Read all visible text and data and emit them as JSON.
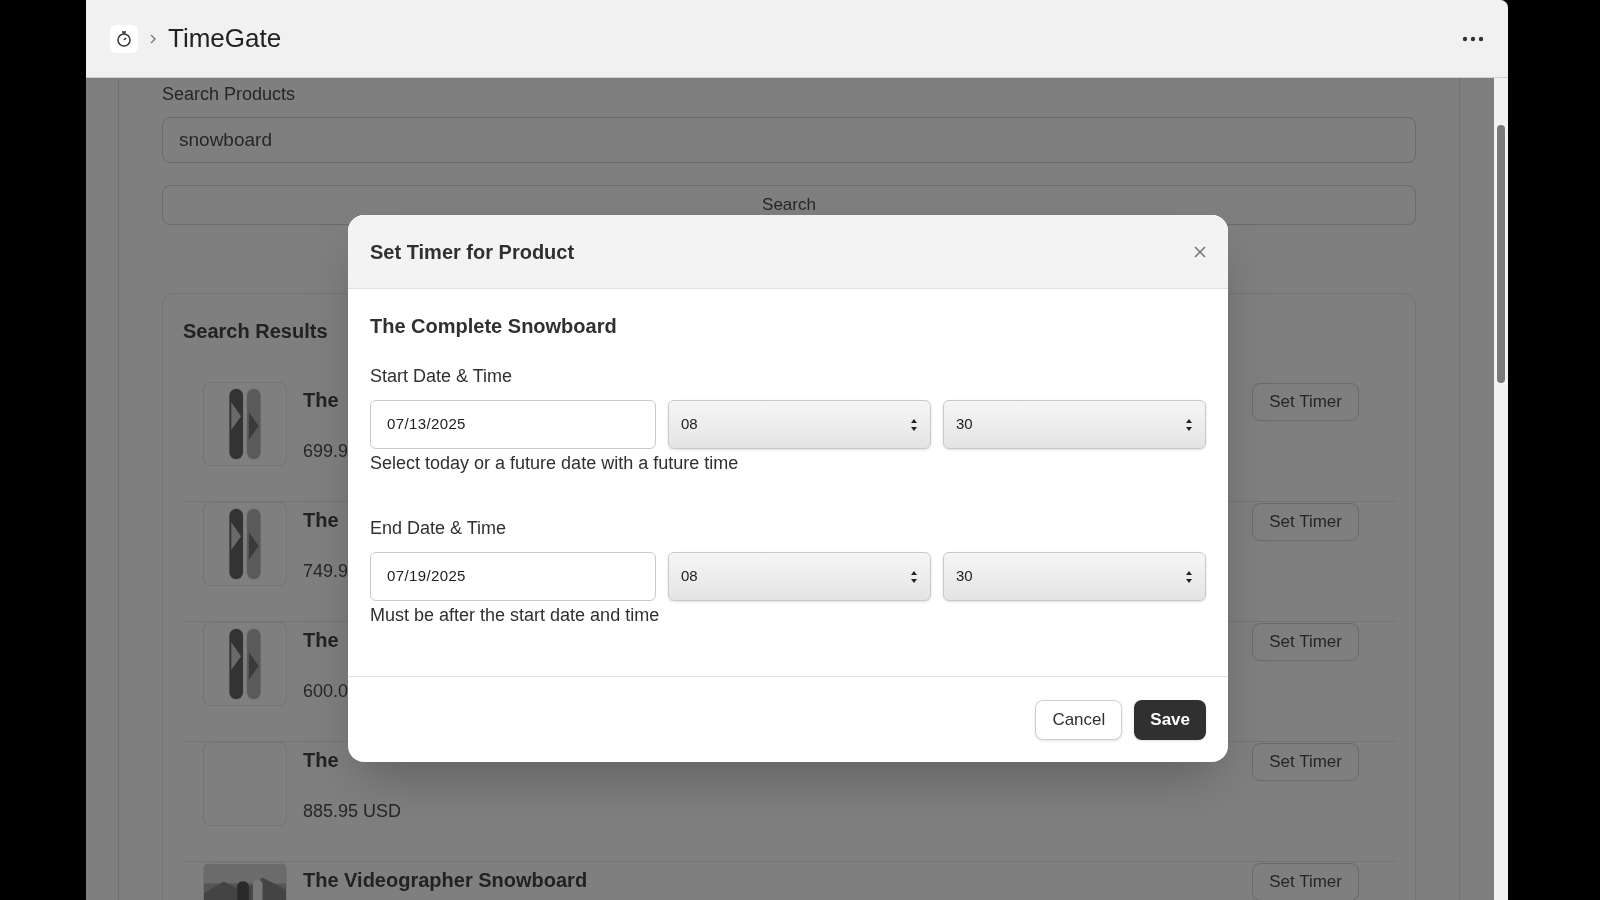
{
  "header": {
    "app_name": "TimeGate"
  },
  "search": {
    "label": "Search Products",
    "value": "snowboard",
    "button": "Search"
  },
  "results": {
    "title": "Search Results",
    "rows": [
      {
        "name": "The",
        "price": "699.9",
        "kind": "picture",
        "button": "Set Timer"
      },
      {
        "name": "The",
        "price": "749.9",
        "kind": "picture",
        "button": "Set Timer"
      },
      {
        "name": "The",
        "price": "600.0",
        "kind": "picture",
        "button": "Set Timer"
      },
      {
        "name": "The",
        "price": "885.95 USD",
        "kind": "empty",
        "button": "Set Timer"
      },
      {
        "name": "The Videographer Snowboard",
        "kind": "picture",
        "button": "Set Timer"
      }
    ]
  },
  "dialog": {
    "title": "Set Timer for Product",
    "product": "The Complete Snowboard",
    "sections": [
      {
        "label": "Start Date & Time",
        "date": "07/13/2025",
        "hour": "08",
        "minute": "30",
        "help": "Select today or a future date with a future time"
      },
      {
        "label": "End Date & Time",
        "date": "07/19/2025",
        "hour": "08",
        "minute": "30",
        "help": "Must be after the start date and time"
      }
    ],
    "cancel": "Cancel",
    "save": "Save"
  }
}
